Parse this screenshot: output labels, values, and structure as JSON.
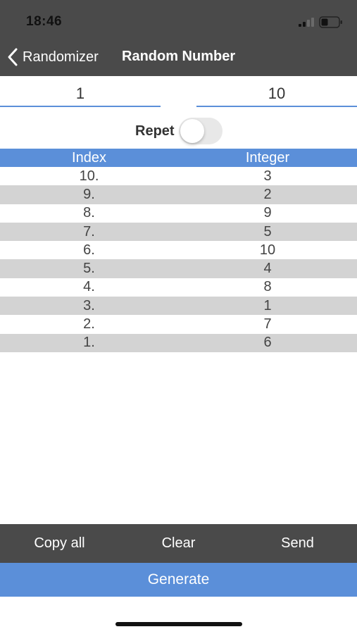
{
  "status_bar": {
    "time": "18:46",
    "signal_icon": "signal-icon",
    "battery_icon": "battery-icon"
  },
  "nav": {
    "back_icon": "chevron-left-icon",
    "back_label": "Randomizer",
    "title": "Random Number"
  },
  "range": {
    "min_value": "1",
    "max_value": "10"
  },
  "repeat": {
    "label": "Repet",
    "enabled": false
  },
  "table": {
    "headers": [
      "Index",
      "Integer"
    ],
    "rows": [
      {
        "index": "10.",
        "integer": "3"
      },
      {
        "index": "9.",
        "integer": "2"
      },
      {
        "index": "8.",
        "integer": "9"
      },
      {
        "index": "7.",
        "integer": "5"
      },
      {
        "index": "6.",
        "integer": "10"
      },
      {
        "index": "5.",
        "integer": "4"
      },
      {
        "index": "4.",
        "integer": "8"
      },
      {
        "index": "3.",
        "integer": "1"
      },
      {
        "index": "2.",
        "integer": "7"
      },
      {
        "index": "1.",
        "integer": "6"
      }
    ]
  },
  "toolbar": {
    "copy_all_label": "Copy all",
    "clear_label": "Clear",
    "send_label": "Send"
  },
  "generate_label": "Generate",
  "colors": {
    "accent": "#5b8fd9",
    "bar_background": "#4a4a4a",
    "stripe": "#d3d3d3"
  }
}
